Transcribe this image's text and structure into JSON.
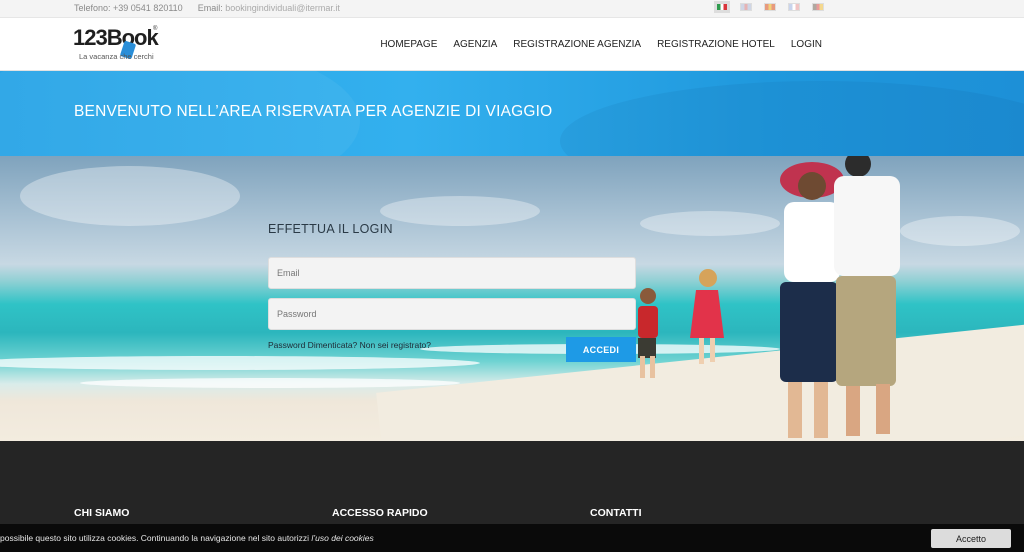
{
  "topbar": {
    "phone_label": "Telefono: +39 0541 820110",
    "email_prefix": "Email:",
    "email_value": "bookingindividuali@itermar.it",
    "flags": [
      {
        "name": "flag-it-icon",
        "colors": [
          "#2e9b4e",
          "#ffffff",
          "#d9353b"
        ]
      },
      {
        "name": "flag-en-icon",
        "colors": [
          "#cfd6e6",
          "#e6b3b3",
          "#cfd6e6"
        ]
      },
      {
        "name": "flag-es-icon",
        "colors": [
          "#e79a7e",
          "#f2d27a",
          "#e79a7e"
        ]
      },
      {
        "name": "flag-fr-icon",
        "colors": [
          "#c9d4ec",
          "#ffffff",
          "#f0c4c4"
        ]
      },
      {
        "name": "flag-de-icon",
        "colors": [
          "#b0a8a0",
          "#e99a9a",
          "#f4d88e"
        ]
      }
    ]
  },
  "header": {
    "logo_text": "123Book",
    "logo_reg": "®",
    "slogan": "La vacanza che cerchi",
    "nav": [
      "HOMEPAGE",
      "AGENZIA",
      "REGISTRAZIONE AGENZIA",
      "REGISTRAZIONE HOTEL",
      "LOGIN"
    ]
  },
  "banner": {
    "title": "BENVENUTO NELL’AREA RISERVATA PER AGENZIE DI VIAGGIO"
  },
  "login": {
    "title": "EFFETTUA IL LOGIN",
    "email_placeholder": "Email",
    "password_placeholder": "Password",
    "forgot_link": "Password Dimenticata?",
    "register_link": "Non sei registrato?",
    "submit_label": "ACCEDI"
  },
  "footer": {
    "col1_title": "CHI SIAMO",
    "col2_title": "ACCESSO RAPIDO",
    "col3_title": "CONTATTI"
  },
  "cookie": {
    "message": "possibile questo sito utilizza cookies. Continuando la navigazione nel sito autorizzi",
    "link": "l’uso dei cookies",
    "accept_label": "Accetto"
  },
  "colors": {
    "accent": "#1e9ae6",
    "banner": "#28a4e6",
    "footer": "#252525"
  }
}
